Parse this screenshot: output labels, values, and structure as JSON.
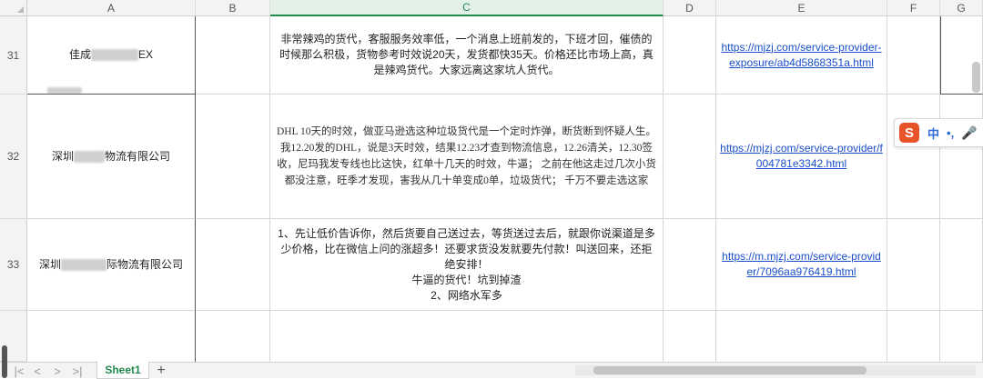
{
  "columns": [
    "A",
    "B",
    "C",
    "D",
    "E",
    "F",
    "G"
  ],
  "rows": [
    {
      "num": "31",
      "a_prefix": "佳成",
      "a_suffix": "EX",
      "c": "非常辣鸡的货代，客服服务效率低，一个消息上班前发的，下班才回，催债的时候那么积极，货物参考时效说20天，发货都快35天。价格还比市场上高，真是辣鸡货代。大家远离这家坑人货代。",
      "e": "https://mjzj.com/service-provider-exposure/ab4d5868351a.html"
    },
    {
      "num": "32",
      "a_prefix": "深圳",
      "a_suffix": "物流有限公司",
      "c": "DHL 10天的时效，做亚马逊选这种垃圾货代是一个定时炸弹，断货断到怀疑人生。我12.20发的DHL，说是3天时效，结果12.23才查到物流信息，12.26清关，12.30签收，尼玛我发专线也比这快，红单十几天的时效，牛逼； 之前在他这走过几次小货都没注意，旺季才发现，害我从几十单变成0单，垃圾货代； 千万不要走选这家",
      "e": "https://mjzj.com/service-provider/f004781e3342.html"
    },
    {
      "num": "33",
      "a_prefix": "深圳",
      "a_suffix": "际物流有限公司",
      "c_lines": [
        "1、先让低价告诉你，然后货要自己送过去，等货送过去后，就跟你说渠道是多少价格，比在微信上问的涨超多！还要求货没发就要先付款！叫送回来，还拒绝安排！",
        "牛逼的货代！坑到掉渣",
        "2、网络水军多"
      ],
      "e": "https://m.mjzj.com/service-provider/7096aa976419.html"
    }
  ],
  "sheet_tab": "Sheet1",
  "ime": {
    "logo": "S",
    "mode": "中",
    "punct": "•,",
    "voice": "🎤"
  },
  "nav": {
    "first": "|<",
    "prev": "<",
    "next": ">",
    "last": ">|",
    "add": "+"
  }
}
